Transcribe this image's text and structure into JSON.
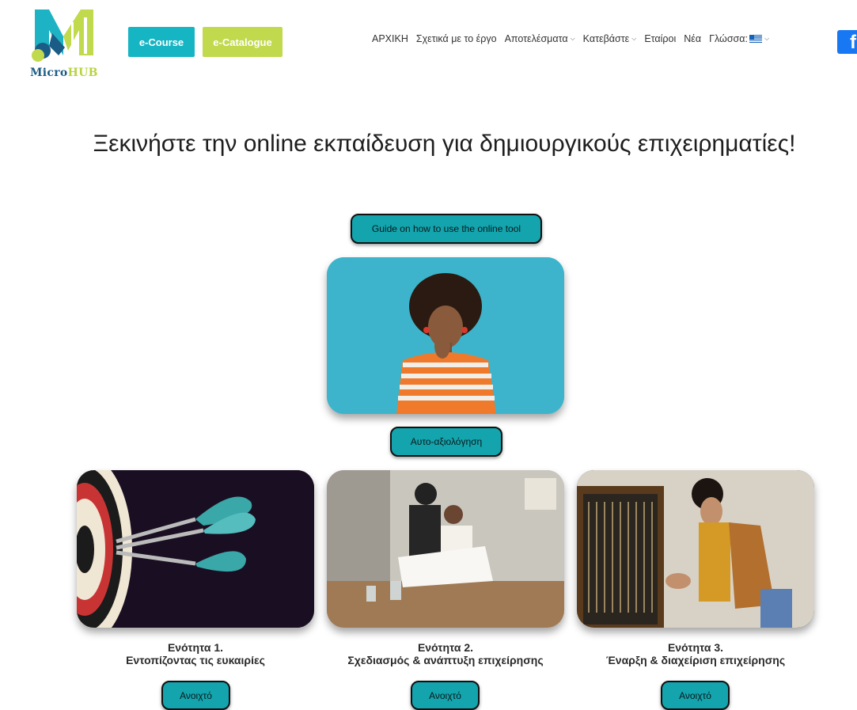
{
  "header": {
    "logo": {
      "micro": "Micro",
      "hub": "HUB"
    },
    "ecourse_label": "e-Course",
    "ecatalogue_label": "e-Catalogue",
    "nav": [
      {
        "label": "ΑΡΧΙΚΗ",
        "dropdown": false
      },
      {
        "label": "Σχετικά με το έργο",
        "dropdown": false
      },
      {
        "label": "Αποτελέσματα",
        "dropdown": true
      },
      {
        "label": "Κατεβάστε",
        "dropdown": true
      },
      {
        "label": "Εταίροι",
        "dropdown": false
      },
      {
        "label": "Νέα",
        "dropdown": false
      },
      {
        "label": "Γλώσσα:",
        "dropdown": true
      }
    ],
    "facebook_glyph": "f"
  },
  "main": {
    "title": "Ξεκινήστε την online εκπαίδευση για δημιουργικούς επιχειρηματίες!",
    "guide_button": "Guide on how to use the online tool",
    "self_eval_button": "Αυτο-αξιολόγηση",
    "units": [
      {
        "line1": "Ενότητα 1.",
        "line2": "Εντοπίζοντας τις ευκαιρίες",
        "button": "Ανοιχτό"
      },
      {
        "line1": "Ενότητα 2.",
        "line2": "Σχεδιασμός & ανάπτυξη επιχείρησης",
        "button": "Ανοιχτό"
      },
      {
        "line1": "Ενότητα 3.",
        "line2": "Έναρξη & διαχείριση επιχείρησης",
        "button": "Ανοιχτό"
      }
    ]
  },
  "colors": {
    "ecourse": "#16b5c4",
    "ecatalogue": "#c1d94d",
    "pill": "#13a4ae",
    "facebook": "#1877f2"
  },
  "icons": [
    "microhub-logo-icon",
    "chevron-down-icon",
    "greek-flag-icon",
    "facebook-icon"
  ]
}
